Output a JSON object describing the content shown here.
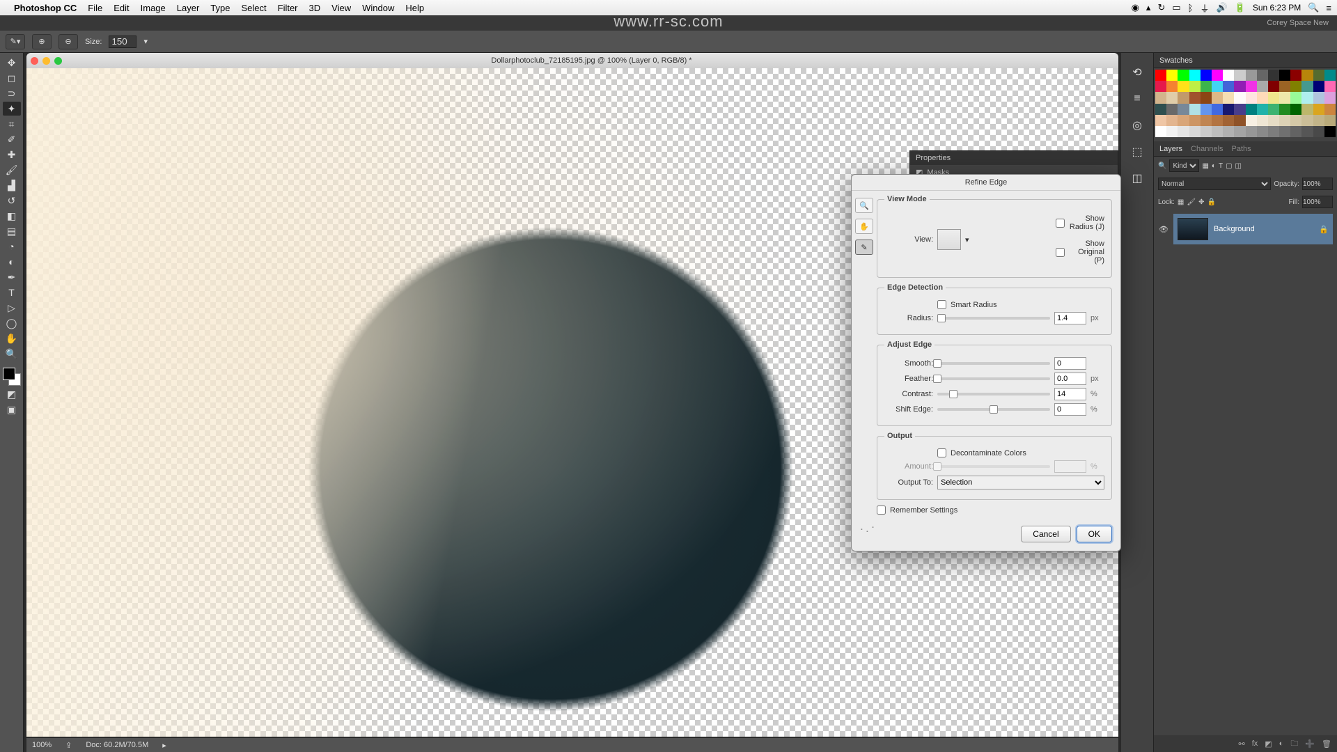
{
  "menubar": {
    "app": "Photoshop CC",
    "items": [
      "File",
      "Edit",
      "Image",
      "Layer",
      "Type",
      "Select",
      "Filter",
      "3D",
      "View",
      "Window",
      "Help"
    ],
    "clock": "Sun 6:23 PM"
  },
  "watermark": "www.rr-sc.com",
  "workspace": {
    "name": "Corey Space New"
  },
  "options": {
    "size_label": "Size:",
    "size_value": "150"
  },
  "document": {
    "title": "Dollarphotoclub_72185195.jpg @ 100% (Layer 0, RGB/8) *",
    "zoom": "100%",
    "doc_info": "Doc: 60.2M/70.5M"
  },
  "panels": {
    "swatches": {
      "title": "Swatches"
    },
    "properties": {
      "title": "Properties",
      "sub": "Masks"
    },
    "layers": {
      "tabs": [
        "Layers",
        "Channels",
        "Paths"
      ],
      "kind": "Kind",
      "mode": "Normal",
      "opacity_label": "Opacity:",
      "opacity": "100%",
      "lock_label": "Lock:",
      "fill_label": "Fill:",
      "fill": "100%",
      "layer_name": "Background"
    }
  },
  "swatch_colors": [
    "#ff0000",
    "#ffff00",
    "#00ff00",
    "#00ffff",
    "#0000ff",
    "#ff00ff",
    "#ffffff",
    "#cccccc",
    "#999999",
    "#666666",
    "#333333",
    "#000000",
    "#8b0000",
    "#b8860b",
    "#556b2f",
    "#008b8b",
    "#e6194b",
    "#f58231",
    "#ffe119",
    "#bfef45",
    "#3cb44b",
    "#42d4f4",
    "#4363d8",
    "#911eb4",
    "#f032e6",
    "#a9a9a9",
    "#800000",
    "#9a6324",
    "#808000",
    "#469990",
    "#000075",
    "#ff69b4",
    "#d2b48c",
    "#e0cda9",
    "#c19a6b",
    "#a0522d",
    "#8b4513",
    "#deb887",
    "#f5deb3",
    "#fffafa",
    "#ffe4e1",
    "#ffdab9",
    "#f0e68c",
    "#eee8aa",
    "#98fb98",
    "#afeeee",
    "#b0c4de",
    "#dda0dd",
    "#2f4f4f",
    "#696969",
    "#778899",
    "#b0e0e6",
    "#6495ed",
    "#4169e1",
    "#191970",
    "#483d8b",
    "#008080",
    "#20b2aa",
    "#3cb371",
    "#228b22",
    "#006400",
    "#bdb76b",
    "#daa520",
    "#cd853f",
    "#efc6a5",
    "#e3b58f",
    "#d9a679",
    "#cd9564",
    "#c08552",
    "#b37442",
    "#a26334",
    "#8f5227",
    "#f8f0e3",
    "#efe6d4",
    "#e6dcc5",
    "#ddd2b6",
    "#d4c8a7",
    "#cbbe98",
    "#c2b489",
    "#b9aa7a",
    "#ffffff",
    "#f2f2f2",
    "#e5e5e5",
    "#d8d8d8",
    "#cbcbcb",
    "#bebebe",
    "#b1b1b1",
    "#a4a4a4",
    "#979797",
    "#8a8a8a",
    "#7d7d7d",
    "#707070",
    "#636363",
    "#565656",
    "#494949",
    "#000000"
  ],
  "dialog": {
    "title": "Refine Edge",
    "view_mode": {
      "legend": "View Mode",
      "view_label": "View:",
      "show_radius": "Show Radius (J)",
      "show_original": "Show Original (P)"
    },
    "edge_detection": {
      "legend": "Edge Detection",
      "smart_radius": "Smart Radius",
      "radius_label": "Radius:",
      "radius": "1.4",
      "radius_unit": "px"
    },
    "adjust_edge": {
      "legend": "Adjust Edge",
      "smooth_label": "Smooth:",
      "smooth": "0",
      "feather_label": "Feather:",
      "feather": "0.0",
      "feather_unit": "px",
      "contrast_label": "Contrast:",
      "contrast": "14",
      "contrast_unit": "%",
      "shift_label": "Shift Edge:",
      "shift": "0",
      "shift_unit": "%"
    },
    "output": {
      "legend": "Output",
      "decon": "Decontaminate Colors",
      "amount_label": "Amount:",
      "output_to_label": "Output To:",
      "output_to": "Selection"
    },
    "remember": "Remember Settings",
    "cancel": "Cancel",
    "ok": "OK"
  }
}
